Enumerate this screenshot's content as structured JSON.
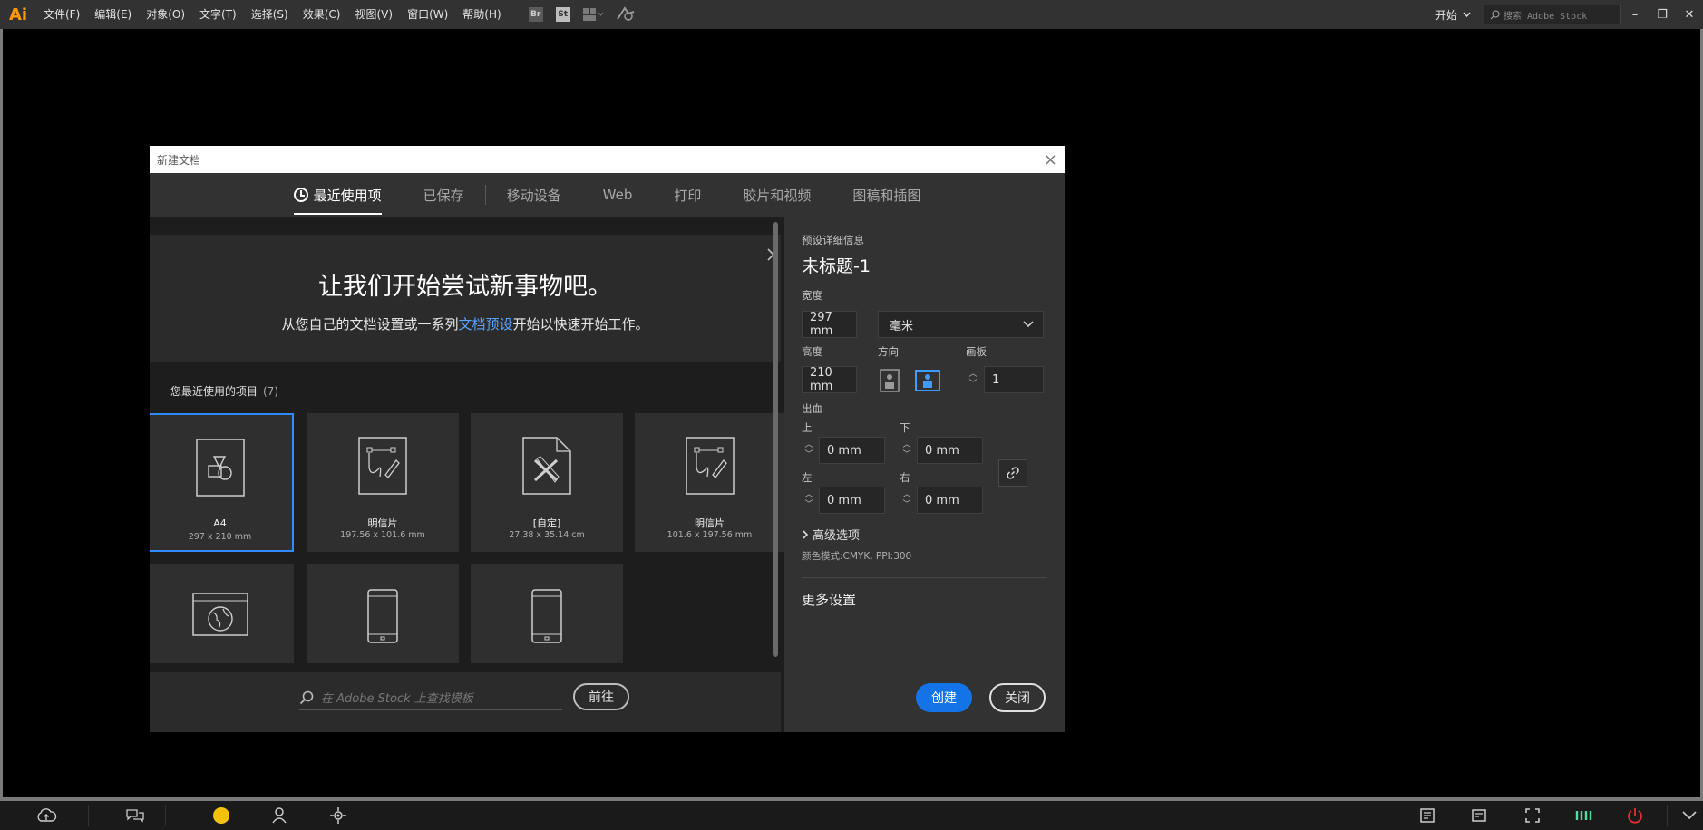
{
  "app": {
    "logo": "Ai",
    "menu": [
      "文件(F)",
      "编辑(E)",
      "对象(O)",
      "文字(T)",
      "选择(S)",
      "效果(C)",
      "视图(V)",
      "窗口(W)",
      "帮助(H)"
    ],
    "toolbar_icons": [
      "bridge-icon",
      "stock-icon",
      "arrange-documents-icon",
      "gpu-performance-icon"
    ],
    "toolbar_icon_labels": {
      "bridge": "Br",
      "stock": "St"
    },
    "workspace_label": "开始",
    "stock_search_placeholder": "搜索 Adobe Stock",
    "window_controls": {
      "minimize": "–",
      "restore": "❐",
      "close": "✕"
    }
  },
  "dialog": {
    "title": "新建文档",
    "close_glyph": "×",
    "tabs": [
      {
        "label": "最近使用项",
        "active": true
      },
      {
        "label": "已保存",
        "active": false
      },
      {
        "label": "移动设备",
        "active": false
      },
      {
        "label": "Web",
        "active": false
      },
      {
        "label": "打印",
        "active": false
      },
      {
        "label": "胶片和视频",
        "active": false
      },
      {
        "label": "图稿和插图",
        "active": false
      }
    ],
    "hero": {
      "title": "让我们开始尝试新事物吧。",
      "sub_before": "从您自己的文档设置或一系列",
      "sub_link": "文档预设",
      "sub_after": "开始以快速开始工作。"
    },
    "recent": {
      "label": "您最近使用的项目",
      "count": "(7)",
      "items": [
        {
          "name": "A4",
          "size": "297 x 210 mm",
          "icon": "shapes-document-icon",
          "selected": true
        },
        {
          "name": "明信片",
          "size": "197.56 x 101.6 mm",
          "icon": "pen-document-icon",
          "selected": false
        },
        {
          "name": "[自定]",
          "size": "27.38 x 35.14 cm",
          "icon": "tools-document-icon",
          "selected": false
        },
        {
          "name": "明信片",
          "size": "101.6 x 197.56 mm",
          "icon": "pen-document-icon",
          "selected": false
        },
        {
          "name": "",
          "size": "",
          "icon": "web-globe-icon",
          "selected": false
        },
        {
          "name": "",
          "size": "",
          "icon": "phone-device-icon",
          "selected": false
        },
        {
          "name": "",
          "size": "",
          "icon": "tablet-device-icon",
          "selected": false
        }
      ]
    },
    "stock": {
      "placeholder": "在 Adobe Stock 上查找模板",
      "go_label": "前往"
    },
    "preset": {
      "section_label": "预设详细信息",
      "doc_name": "未标题-1",
      "width_label": "宽度",
      "width_value": "297 mm",
      "unit": "毫米",
      "height_label": "高度",
      "height_value": "210 mm",
      "orientation_label": "方向",
      "orientation": "landscape",
      "artboards_label": "画板",
      "artboards_value": "1",
      "bleed_label": "出血",
      "bleed": {
        "top_label": "上",
        "top": "0 mm",
        "bottom_label": "下",
        "bottom": "0 mm",
        "left_label": "左",
        "left": "0 mm",
        "right_label": "右",
        "right": "0 mm"
      },
      "advanced_label": "高级选项",
      "color_mode": "颜色模式:CMYK, PPI:300",
      "more_settings": "更多设置",
      "create_label": "创建",
      "close_label": "关闭"
    }
  },
  "taskbar": {
    "icons": [
      "cloud-upload-icon",
      "chat-icon",
      "status-dot-icon",
      "user-settings-icon",
      "location-icon",
      "clipboard-icon",
      "screen-icon",
      "fullscreen-icon",
      "network-icon",
      "power-icon",
      "chevron-down-icon"
    ],
    "accent": "#f4c20d"
  },
  "colors": {
    "accent_blue": "#1473e6",
    "link_blue": "#5aa6ff",
    "ai_orange": "#ff9a00"
  }
}
